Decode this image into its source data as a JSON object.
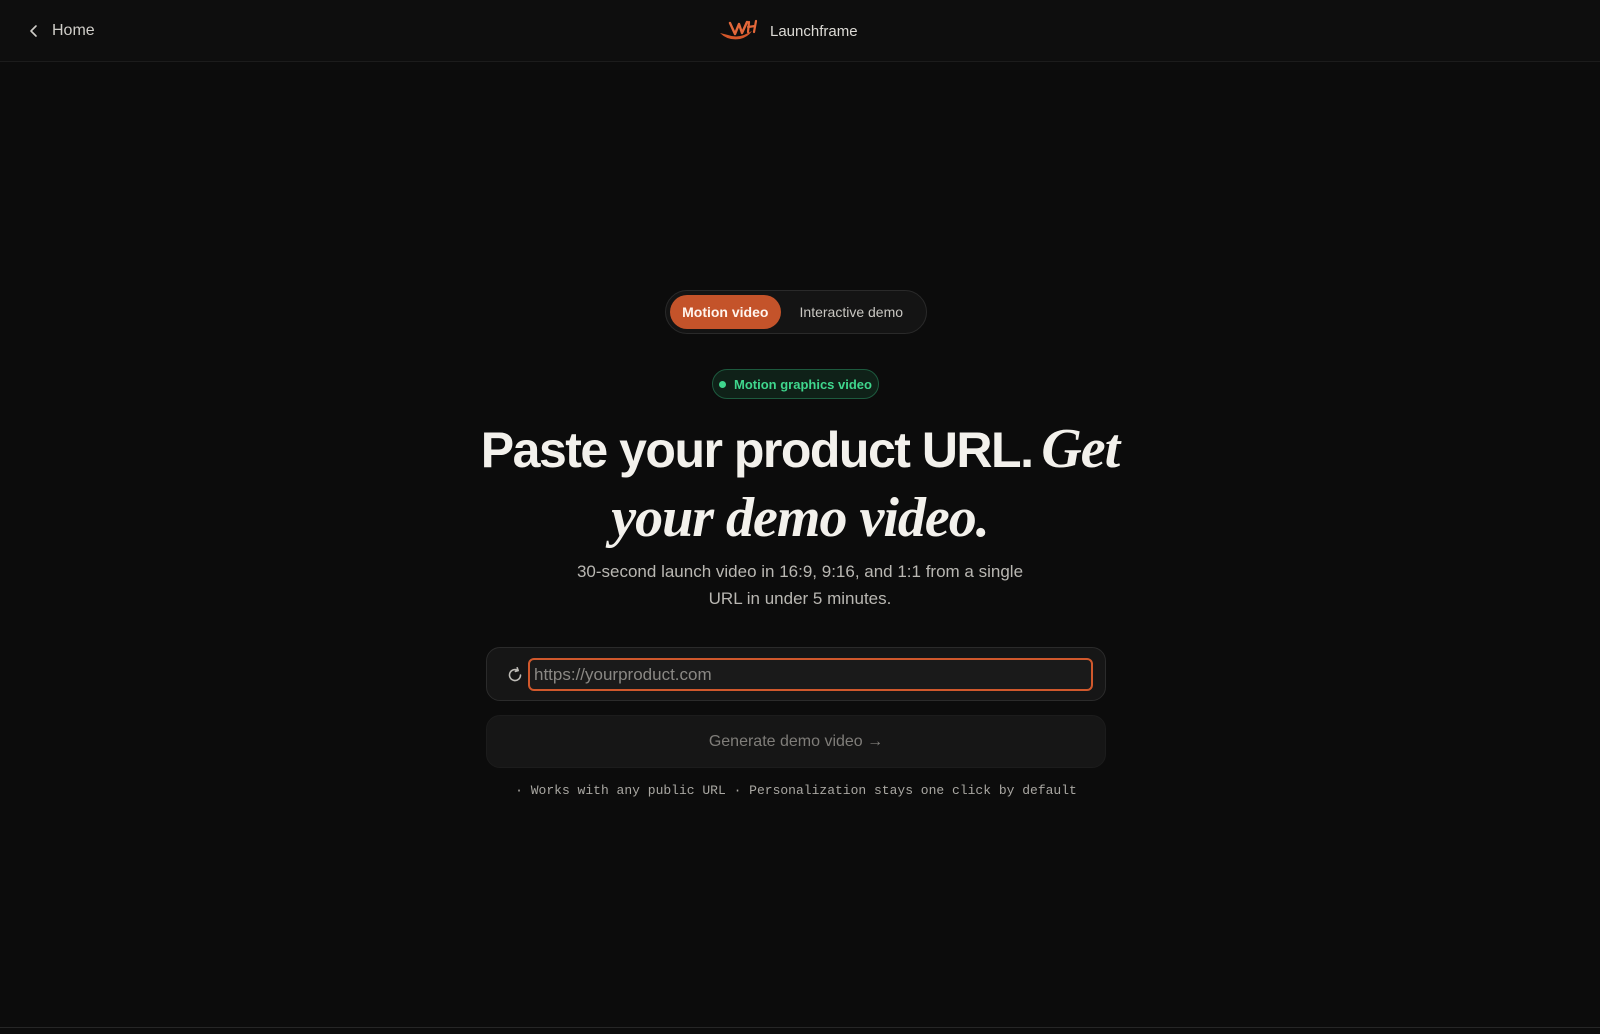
{
  "header": {
    "back_label": "Home",
    "brand_name": "Launchframe"
  },
  "mode_toggle": {
    "options": [
      {
        "label": "Motion video",
        "active": true
      },
      {
        "label": "Interactive demo",
        "active": false
      }
    ]
  },
  "badge": {
    "label": "Motion graphics video",
    "color": "#3fd68d"
  },
  "headline": {
    "plain": "Paste your product URL.",
    "italic": "Get your demo video."
  },
  "subtitle": "30-second launch video in 16:9, 9:16, and 1:1 from a single URL in under 5 minutes.",
  "url_field": {
    "value": "",
    "placeholder": "https://yourproduct.com",
    "icon": "refresh-icon"
  },
  "generate_button": {
    "label": "Generate demo video →"
  },
  "footnote": "· Works with any public URL · Personalization stays one click by default",
  "colors": {
    "accent": "#c4532a",
    "background": "#0c0c0c",
    "badge_green": "#3fd68d"
  }
}
